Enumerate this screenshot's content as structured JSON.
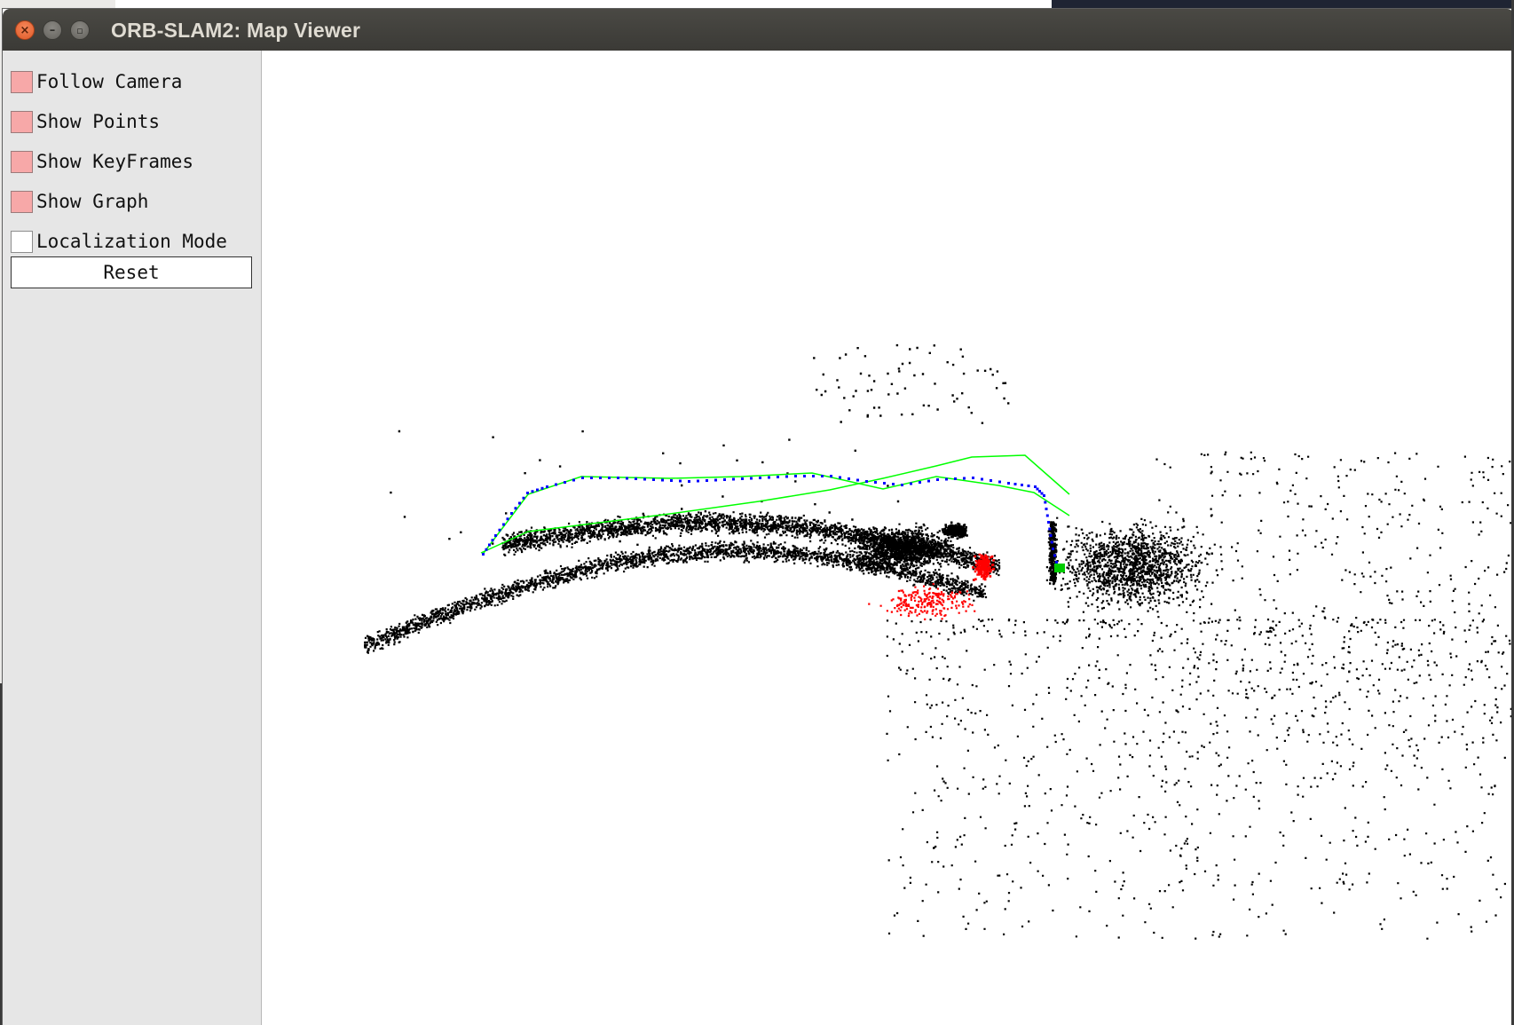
{
  "window": {
    "title": "ORB-SLAM2: Map Viewer",
    "close_glyph": "×",
    "minimize_glyph": "–",
    "maximize_glyph": "▫"
  },
  "panel": {
    "follow_camera": {
      "label": "Follow Camera",
      "checked": true
    },
    "show_points": {
      "label": "Show Points",
      "checked": true
    },
    "show_keyframes": {
      "label": "Show KeyFrames",
      "checked": true
    },
    "show_graph": {
      "label": "Show Graph",
      "checked": true
    },
    "localization_mode": {
      "label": "Localization Mode",
      "checked": false
    },
    "reset_label": "Reset"
  },
  "colors": {
    "checkbox_on": "#f7a8a8",
    "map_points": "#000000",
    "reference_points": "#ff0000",
    "keyframes": "#0000ff",
    "graph": "#00ff00",
    "current_camera": "#00cc00"
  }
}
